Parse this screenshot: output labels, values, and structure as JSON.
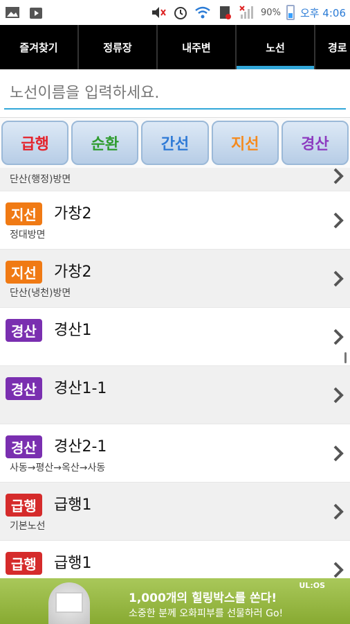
{
  "status_bar": {
    "battery": "90%",
    "time": "오후 4:06",
    "icons": [
      "image-icon",
      "play-store-icon",
      "mute-icon",
      "alarm-icon",
      "wifi-icon",
      "sim-icon",
      "signal-icon",
      "battery-icon"
    ]
  },
  "tabs": [
    {
      "label": "즐겨찾기",
      "active": false
    },
    {
      "label": "정류장",
      "active": false
    },
    {
      "label": "내주변",
      "active": false
    },
    {
      "label": "노선",
      "active": true
    },
    {
      "label": "경로",
      "active": false
    }
  ],
  "search": {
    "placeholder": "노선이름을 입력하세요."
  },
  "filters": [
    {
      "label": "급행",
      "color": "#e4222b"
    },
    {
      "label": "순환",
      "color": "#2f9c2f"
    },
    {
      "label": "간선",
      "color": "#2f7ad6"
    },
    {
      "label": "지선",
      "color": "#f58a1e"
    },
    {
      "label": "경산",
      "color": "#8d3bc0"
    }
  ],
  "routes": [
    {
      "badge": "",
      "title": "",
      "subtitle": "단산(행정)방면"
    },
    {
      "badge": "지선",
      "badge_color": "#f07a14",
      "title": "가창2",
      "subtitle": "정대방면"
    },
    {
      "badge": "지선",
      "badge_color": "#f07a14",
      "title": "가창2",
      "subtitle": "단산(냉천)방면"
    },
    {
      "badge": "경산",
      "badge_color": "#7a2fb0",
      "title": "경산1",
      "subtitle": ""
    },
    {
      "badge": "경산",
      "badge_color": "#7a2fb0",
      "title": "경산1-1",
      "subtitle": ""
    },
    {
      "badge": "경산",
      "badge_color": "#7a2fb0",
      "title": "경산2-1",
      "subtitle": "사동→평산→옥산→사동"
    },
    {
      "badge": "급행",
      "badge_color": "#d52b2b",
      "title": "급행1",
      "subtitle": "기본노선"
    },
    {
      "badge": "급행",
      "badge_color": "#d52b2b",
      "title": "급행1",
      "subtitle": ""
    }
  ],
  "ad": {
    "brand": "UL:OS",
    "line1": "1,000개의 힐링박스를 쏜다!",
    "line2": "소중한 분께 오화피부를 선물하러 Go!"
  }
}
